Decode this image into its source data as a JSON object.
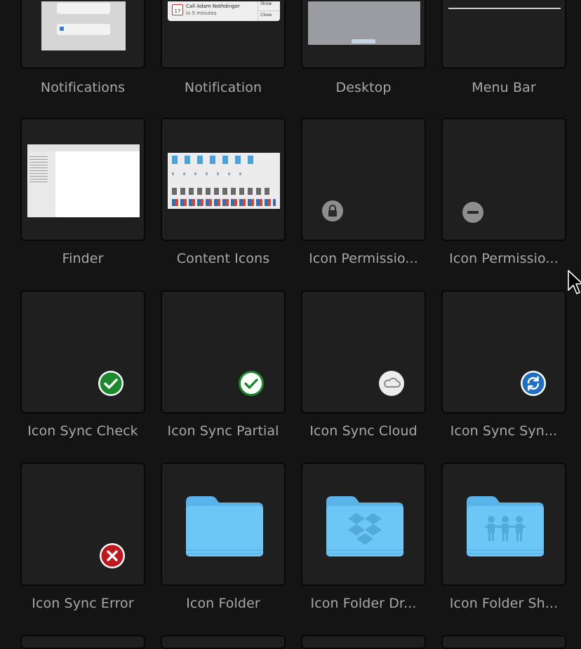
{
  "tiles": [
    {
      "id": "notifications",
      "label": "Notifications"
    },
    {
      "id": "notification",
      "label": "Notification"
    },
    {
      "id": "desktop",
      "label": "Desktop"
    },
    {
      "id": "menu-bar",
      "label": "Menu Bar"
    },
    {
      "id": "finder",
      "label": "Finder"
    },
    {
      "id": "content-icons",
      "label": "Content Icons"
    },
    {
      "id": "icon-permission-lock",
      "label": "Icon Permissio..."
    },
    {
      "id": "icon-permission-minus",
      "label": "Icon Permissio..."
    },
    {
      "id": "icon-sync-check",
      "label": "Icon Sync Check"
    },
    {
      "id": "icon-sync-partial",
      "label": "Icon Sync Partial"
    },
    {
      "id": "icon-sync-cloud",
      "label": "Icon Sync Cloud"
    },
    {
      "id": "icon-sync-syncing",
      "label": "Icon Sync Syn..."
    },
    {
      "id": "icon-sync-error",
      "label": "Icon Sync Error"
    },
    {
      "id": "icon-folder",
      "label": "Icon Folder"
    },
    {
      "id": "icon-folder-dropbox",
      "label": "Icon Folder Dr..."
    },
    {
      "id": "icon-folder-shared",
      "label": "Icon Folder Sh..."
    }
  ],
  "notification_preview": {
    "title": "Call Adam Nothdinger",
    "subtitle": "in 5 minutes",
    "show": "Show",
    "close": "Close",
    "day": "17"
  },
  "colors": {
    "background": "#141414",
    "tile": "#1f1f20",
    "label": "#a9a9a9",
    "check_green": "#1a8a2c",
    "error_red": "#c0161e",
    "sync_blue": "#1e6fc4",
    "folder_blue": "#66c3f4"
  }
}
